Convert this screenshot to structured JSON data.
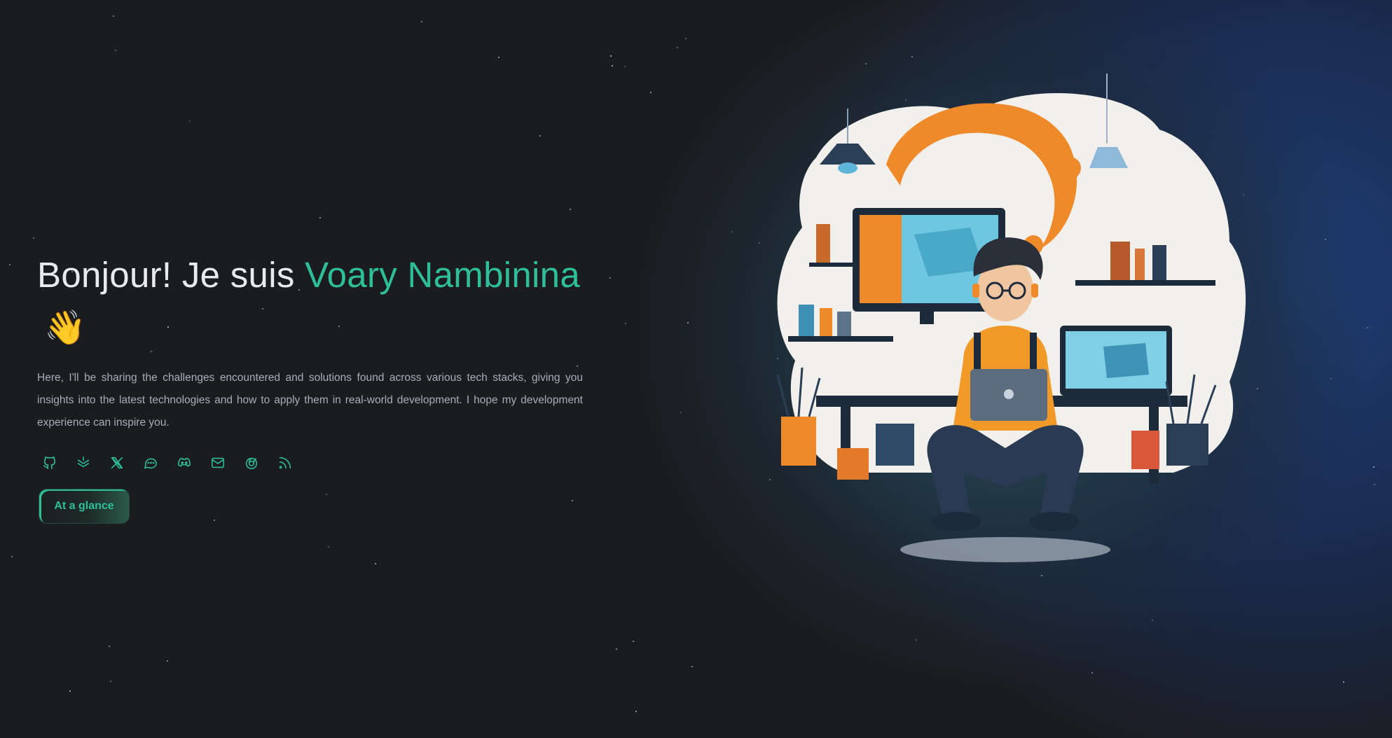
{
  "hero": {
    "greeting": "Bonjour! Je suis ",
    "name": "Voary Nambinina",
    "emoji": "👋",
    "intro": "Here, I'll be sharing the challenges encountered and solutions found across various tech stacks, giving you insights into the latest technologies and how to apply them in real-world development. I hope my development experience can inspire you."
  },
  "socials": [
    {
      "icon": "github-icon"
    },
    {
      "icon": "layers-icon"
    },
    {
      "icon": "x-icon"
    },
    {
      "icon": "chat-icon"
    },
    {
      "icon": "discord-icon"
    },
    {
      "icon": "mail-icon"
    },
    {
      "icon": "spiral-icon"
    },
    {
      "icon": "rss-icon"
    }
  ],
  "cta": {
    "label": "At a glance"
  },
  "colors": {
    "accent": "#2fbf98",
    "background": "#1b1c1f",
    "text": "#e9eaec",
    "muted": "#a9adb5"
  }
}
